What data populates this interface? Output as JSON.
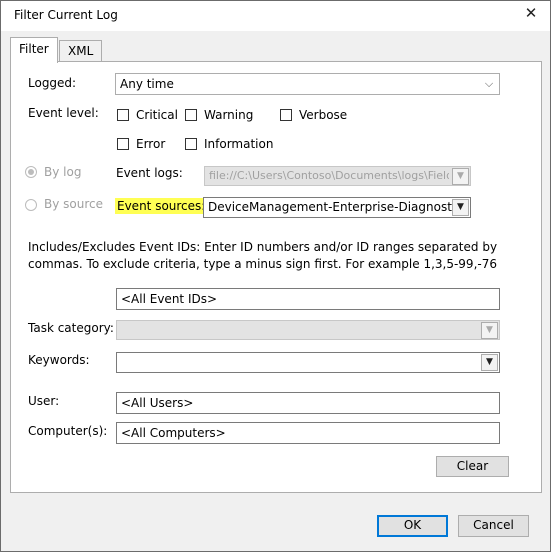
{
  "window": {
    "title": "Filter Current Log",
    "close_glyph": "✕"
  },
  "tabs": [
    {
      "label": "Filter"
    },
    {
      "label": "XML"
    }
  ],
  "logged": {
    "label": "Logged:",
    "value": "Any time"
  },
  "event_level": {
    "label": "Event level:",
    "options": [
      {
        "label": "Critical",
        "checked": false
      },
      {
        "label": "Warning",
        "checked": false
      },
      {
        "label": "Verbose",
        "checked": false
      },
      {
        "label": "Error",
        "checked": false
      },
      {
        "label": "Information",
        "checked": false
      }
    ]
  },
  "by_log": {
    "label": "By log",
    "selected": true
  },
  "by_source": {
    "label": "By source",
    "selected": false
  },
  "event_logs": {
    "label": "Event logs:",
    "value": "file://C:\\Users\\Contoso\\Documents\\logs\\FieldMedi"
  },
  "event_sources": {
    "label": "Event sources:",
    "value": "DeviceManagement-Enterprise-Diagnostics-Pr",
    "highlight_color": "#ffff54"
  },
  "event_ids": {
    "description": "Includes/Excludes Event IDs: Enter ID numbers and/or ID ranges separated by commas. To exclude criteria, type a minus sign first. For example 1,3,5-99,-76",
    "value": "<All Event IDs>"
  },
  "task_category": {
    "label": "Task category:",
    "value": ""
  },
  "keywords": {
    "label": "Keywords:",
    "value": ""
  },
  "user": {
    "label": "User:",
    "value": "<All Users>"
  },
  "computer": {
    "label": "Computer(s):",
    "value": "<All Computers>"
  },
  "buttons": {
    "clear": "Clear",
    "ok": "OK",
    "cancel": "Cancel"
  },
  "icons": {
    "dropdown": "chevron-down-icon",
    "dropdown_glyph": "▼"
  }
}
